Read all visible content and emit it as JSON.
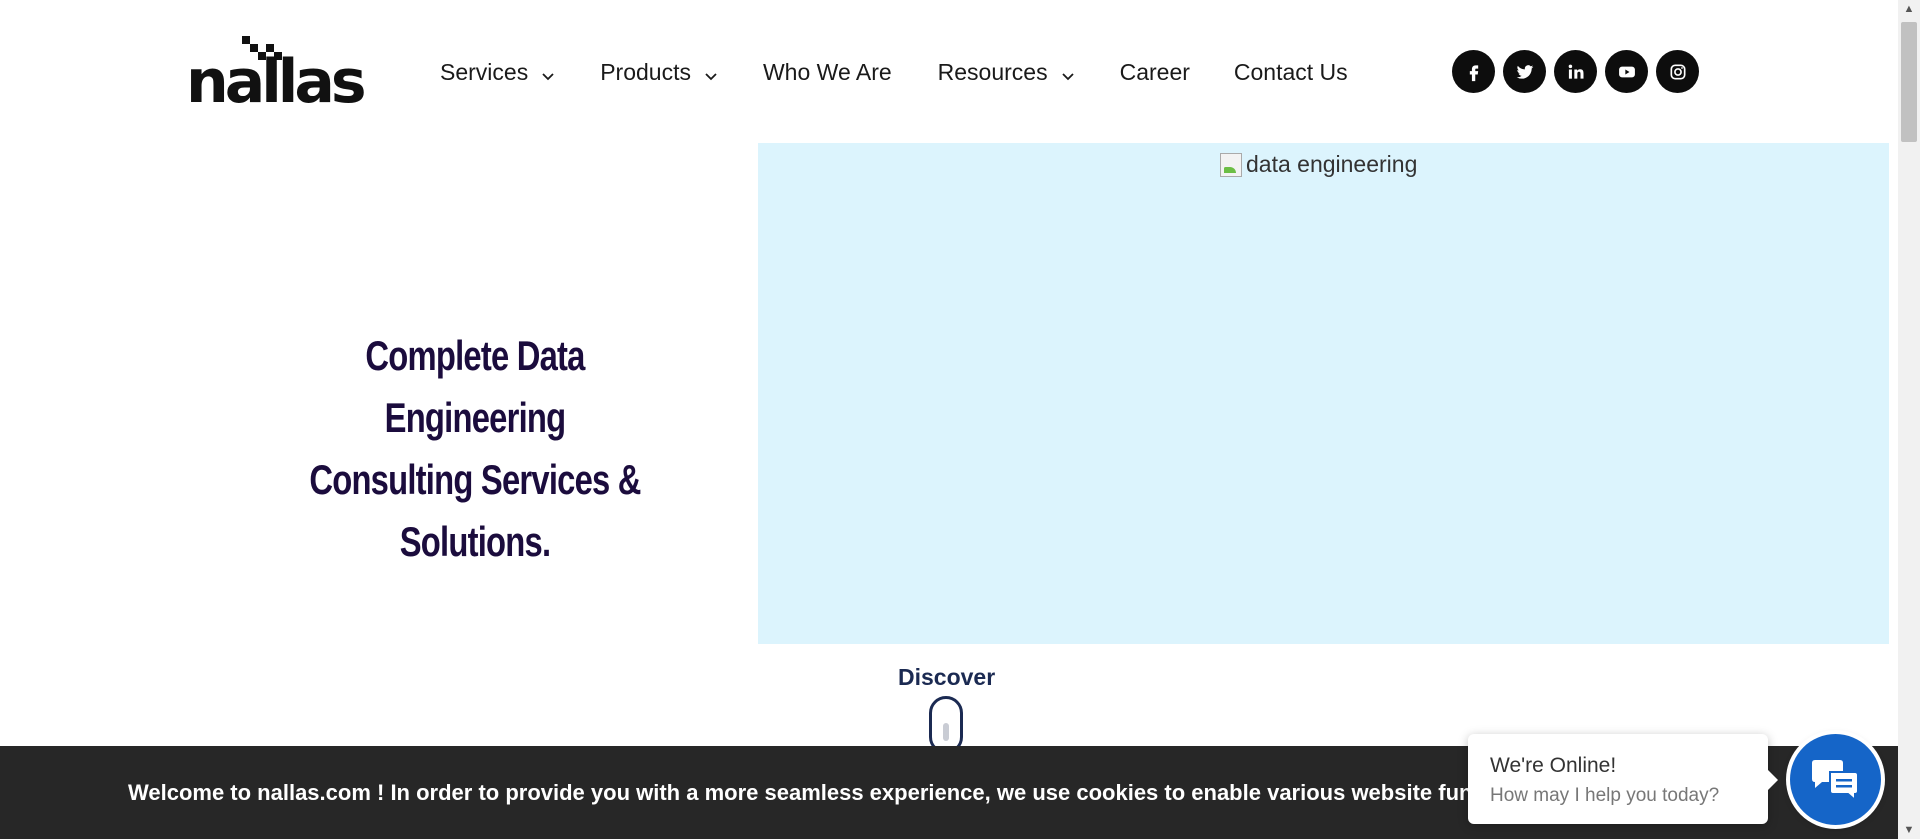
{
  "header": {
    "logo_text": "nallas",
    "logo_registered": "®",
    "nav": [
      {
        "label": "Services",
        "has_dropdown": true
      },
      {
        "label": "Products",
        "has_dropdown": true
      },
      {
        "label": "Who We Are",
        "has_dropdown": false
      },
      {
        "label": "Resources",
        "has_dropdown": true
      },
      {
        "label": "Career",
        "has_dropdown": false
      },
      {
        "label": "Contact Us",
        "has_dropdown": false
      }
    ],
    "social": [
      "facebook-icon",
      "twitter-icon",
      "linkedin-icon",
      "youtube-icon",
      "instagram-icon"
    ]
  },
  "hero": {
    "title_line1": "Complete Data Engineering",
    "title_line2": "Consulting Services & Solutions.",
    "image_alt": "data engineering",
    "image_bg": "#dcf4fd"
  },
  "discover": {
    "label": "Discover"
  },
  "cookie": {
    "text": "Welcome to nallas.com ! In order to provide you with a more seamless experience, we use cookies to enable various website functionality.",
    "link_visible": "s"
  },
  "chat": {
    "title": "We're Online!",
    "subtitle": "How may I help you today?",
    "button_color": "#1565c8"
  },
  "colors": {
    "title": "#1b0c3d",
    "cookie_bg": "#272727"
  }
}
